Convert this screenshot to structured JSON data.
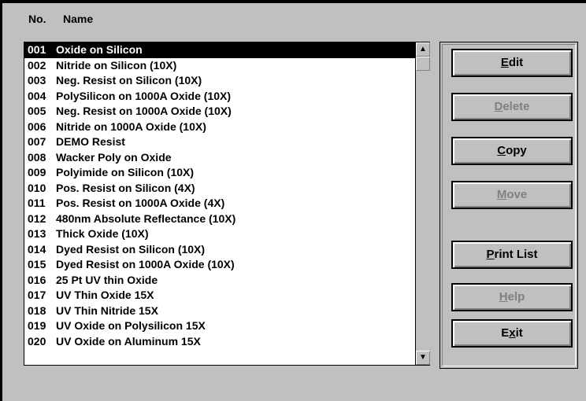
{
  "header": {
    "no_label": "No.",
    "name_label": "Name"
  },
  "list": {
    "items": [
      {
        "no": "001",
        "name": "Oxide on Silicon"
      },
      {
        "no": "002",
        "name": "Nitride on Silicon (10X)"
      },
      {
        "no": "003",
        "name": "Neg. Resist on Silicon (10X)"
      },
      {
        "no": "004",
        "name": "PolySilicon on 1000A Oxide (10X)"
      },
      {
        "no": "005",
        "name": "Neg. Resist on 1000A Oxide (10X)"
      },
      {
        "no": "006",
        "name": "Nitride on 1000A Oxide (10X)"
      },
      {
        "no": "007",
        "name": "DEMO Resist"
      },
      {
        "no": "008",
        "name": "Wacker Poly on Oxide"
      },
      {
        "no": "009",
        "name": "Polyimide on Silicon (10X)"
      },
      {
        "no": "010",
        "name": "Pos. Resist on Silicon (4X)"
      },
      {
        "no": "011",
        "name": "Pos. Resist on 1000A Oxide (4X)"
      },
      {
        "no": "012",
        "name": "480nm Absolute Reflectance (10X)"
      },
      {
        "no": "013",
        "name": "Thick Oxide (10X)"
      },
      {
        "no": "014",
        "name": "Dyed Resist on Silicon (10X)"
      },
      {
        "no": "015",
        "name": "Dyed Resist on 1000A Oxide (10X)"
      },
      {
        "no": "016",
        "name": "25 Pt UV thin Oxide"
      },
      {
        "no": "017",
        "name": "UV Thin Oxide 15X"
      },
      {
        "no": "018",
        "name": "UV Thin Nitride 15X"
      },
      {
        "no": "019",
        "name": "UV Oxide on Polysilicon 15X"
      },
      {
        "no": "020",
        "name": "UV Oxide on Aluminum 15X"
      }
    ],
    "selected_index": 0
  },
  "scrollbar": {
    "up_icon": "arrow-up-icon",
    "down_icon": "arrow-down-icon"
  },
  "buttons": [
    {
      "key": "edit",
      "pre": "",
      "mn": "E",
      "post": "dit",
      "enabled": true
    },
    {
      "key": "delete",
      "pre": "",
      "mn": "D",
      "post": "elete",
      "enabled": false
    },
    {
      "key": "copy",
      "pre": "",
      "mn": "C",
      "post": "opy",
      "enabled": true
    },
    {
      "key": "move",
      "pre": "",
      "mn": "M",
      "post": "ove",
      "enabled": false
    },
    {
      "key": "print-list",
      "pre": "",
      "mn": "P",
      "post": "rint List",
      "enabled": true
    },
    {
      "key": "help",
      "pre": "",
      "mn": "H",
      "post": "elp",
      "enabled": false
    },
    {
      "key": "exit",
      "pre": "E",
      "mn": "x",
      "post": "it",
      "enabled": true
    }
  ]
}
